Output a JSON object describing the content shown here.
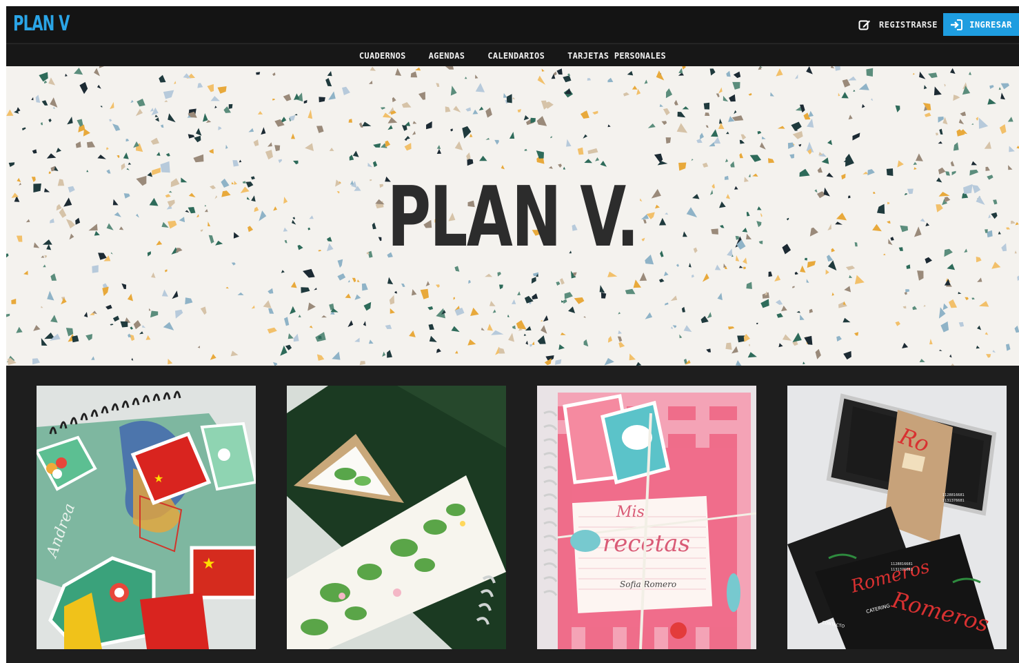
{
  "header": {
    "logo": "PLAN V",
    "register_label": "REGISTRARSE",
    "login_label": "INGRESAR",
    "accent": "#1e9de0"
  },
  "nav": {
    "items": [
      "CUADERNOS",
      "AGENDAS",
      "CALENDARIOS",
      "TARJETAS PERSONALES"
    ]
  },
  "hero": {
    "title": "PLAN V."
  },
  "cards": [
    {
      "name": "cuaderno-mapa",
      "icon": "notebook-map-image"
    },
    {
      "name": "marcapaginas-cactus",
      "icon": "cactus-bookmark-image"
    },
    {
      "name": "recetario",
      "icon": "recipe-notebook-image",
      "script_text": [
        "Mis",
        "recetas"
      ],
      "signature": "Sofia Romero"
    },
    {
      "name": "tarjetas-romeros",
      "icon": "business-cards-image",
      "brand": "Romeros",
      "subtitle": "CATERING",
      "contact": "CONTACTO"
    }
  ]
}
